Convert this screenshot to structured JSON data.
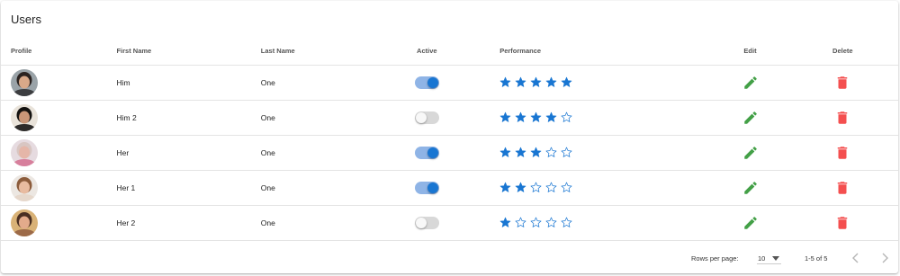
{
  "title": "Users",
  "columns": {
    "profile": "Profile",
    "first_name": "First Name",
    "last_name": "Last Name",
    "active": "Active",
    "performance": "Performance",
    "edit": "Edit",
    "delete": "Delete"
  },
  "rows": [
    {
      "first_name": "Him",
      "last_name": "One",
      "active": true,
      "performance": 5
    },
    {
      "first_name": "Him 2",
      "last_name": "One",
      "active": false,
      "performance": 4
    },
    {
      "first_name": "Her",
      "last_name": "One",
      "active": true,
      "performance": 3
    },
    {
      "first_name": "Her 1",
      "last_name": "One",
      "active": true,
      "performance": 2
    },
    {
      "first_name": "Her 2",
      "last_name": "One",
      "active": false,
      "performance": 1
    }
  ],
  "rating_max": 5,
  "footer": {
    "rows_per_page_label": "Rows per page:",
    "rows_per_page_value": "10",
    "range_text": "1-5 of 5"
  },
  "icons": {
    "edit": "pencil-icon",
    "delete": "trash-icon",
    "star": "star-icon",
    "prev": "chevron-left-icon",
    "next": "chevron-right-icon",
    "dropdown": "caret-down-icon"
  },
  "colors": {
    "accent": "#1976d2",
    "switch_on_track": "#8fb4e6",
    "switch_off_track": "#d8d8d8",
    "switch_off_knob": "#f8f8f8",
    "edit": "#43a047",
    "delete": "#f44f4f",
    "divider": "#e4e4e4"
  }
}
